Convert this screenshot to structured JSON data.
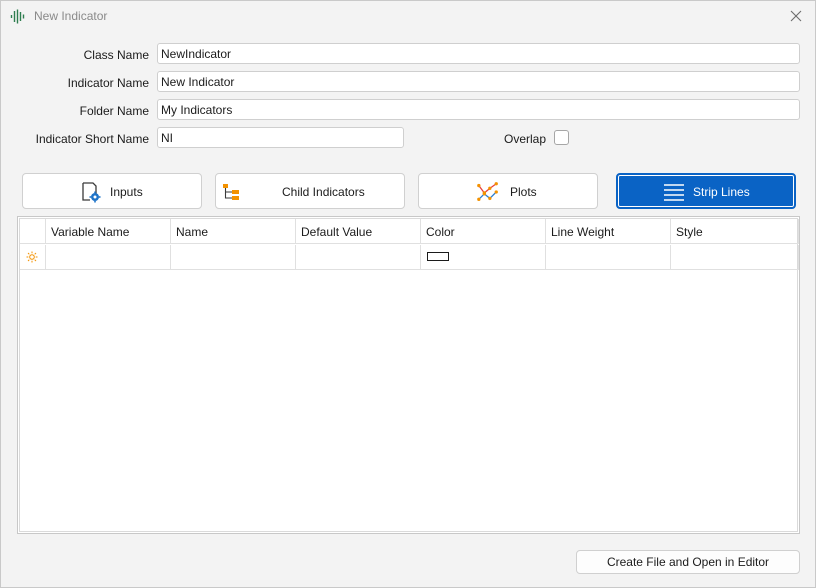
{
  "window": {
    "title": "New Indicator"
  },
  "fields": {
    "class_name": {
      "label": "Class Name",
      "value": "NewIndicator"
    },
    "indicator_name": {
      "label": "Indicator Name",
      "value": "New Indicator"
    },
    "folder_name": {
      "label": "Folder Name",
      "value": "My Indicators"
    },
    "short_name": {
      "label": "Indicator Short Name",
      "value": "NI"
    },
    "overlap": {
      "label": "Overlap",
      "checked": false
    }
  },
  "tabs": [
    {
      "label": "Inputs",
      "icon": "input-gear-icon",
      "active": false
    },
    {
      "label": "Child Indicators",
      "icon": "tree-icon",
      "active": false
    },
    {
      "label": "Plots",
      "icon": "plot-chart-icon",
      "active": false
    },
    {
      "label": "Strip Lines",
      "icon": "strip-lines-icon",
      "active": true
    }
  ],
  "grid": {
    "columns": [
      "Variable Name",
      "Name",
      "Default Value",
      "Color",
      "Line Weight",
      "Style"
    ],
    "new_row_icon": "new-row-sun-icon",
    "new_row_color": "#ffffff"
  },
  "colors": {
    "accent": "#0a63c5",
    "title_gray": "#8a8a8a",
    "icon_orange": "#f39200",
    "plot_red": "#e8413c",
    "plot_blue": "#2a7fd4"
  },
  "actions": {
    "create_label": "Create File and Open in Editor"
  }
}
